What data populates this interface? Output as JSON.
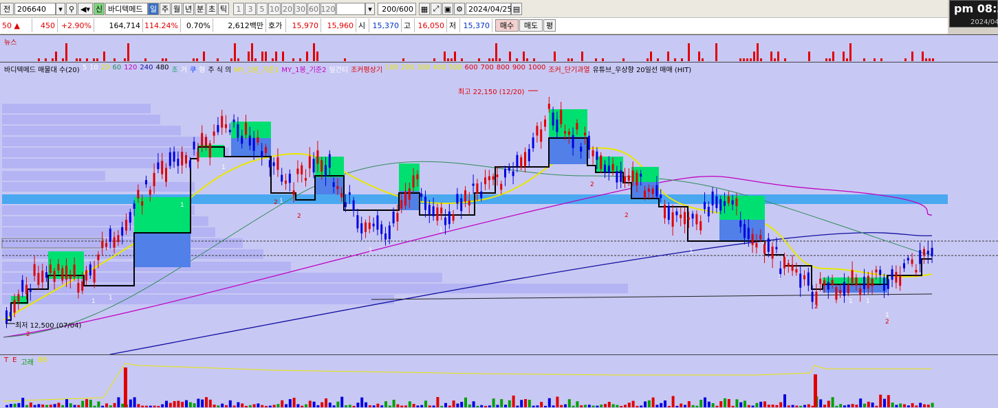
{
  "toolbar": {
    "row1": {
      "prefix": "전",
      "code": "206640",
      "badge": "신",
      "name": "바디텍메드",
      "periods": [
        "일",
        "주",
        "월",
        "년",
        "분",
        "초",
        "틱"
      ],
      "selected_period": "일",
      "numbers": [
        "1",
        "3",
        "5",
        "10",
        "20",
        "30",
        "60",
        "120"
      ],
      "count": "200/600",
      "date": "2024/04/25"
    },
    "row2": {
      "cells": [
        {
          "text": "50 ▲",
          "color": "red"
        },
        {
          "text": "450",
          "color": "red"
        },
        {
          "text": "+2.90%",
          "color": "red"
        },
        {
          "text": "164,714",
          "color": "black"
        },
        {
          "text": "114.24%",
          "color": "red"
        },
        {
          "text": "0.70%",
          "color": "black"
        },
        {
          "text": "2,612백만",
          "color": "black"
        },
        {
          "text": "호가",
          "color": "black"
        },
        {
          "text": "15,970",
          "color": "red"
        },
        {
          "text": "15,960",
          "color": "red"
        },
        {
          "text": "시",
          "color": "black"
        },
        {
          "text": "15,370",
          "color": "blue"
        },
        {
          "text": "고",
          "color": "black"
        },
        {
          "text": "16,050",
          "color": "red"
        },
        {
          "text": "저",
          "color": "black"
        },
        {
          "text": "15,370",
          "color": "blue"
        }
      ],
      "buy_label": "매수",
      "sell_label": "매도",
      "avg_label": "평"
    }
  },
  "clock": {
    "time": "pm 08:3",
    "date": "2024/04"
  },
  "news_panel": {
    "title": "뉴스"
  },
  "price_panel": {
    "legend": [
      {
        "text": "바디텍메드 매물대 수(20)",
        "color": "#000000"
      },
      {
        "text": "5",
        "color": "#ffffff"
      },
      {
        "text": "10",
        "color": "#ffffff"
      },
      {
        "text": "20",
        "color": "#e8e800"
      },
      {
        "text": "60",
        "color": "#2e8b57"
      },
      {
        "text": "120",
        "color": "#c000c0"
      },
      {
        "text": "240",
        "color": "#1010a0"
      },
      {
        "text": "480",
        "color": "#000000"
      },
      {
        "text": "조",
        "color": "#00a060"
      },
      {
        "text": "거",
        "color": "#ffffff"
      },
      {
        "text": "쿠",
        "color": "#0040ff"
      },
      {
        "text": "형",
        "color": "#ffffff"
      },
      {
        "text": "주 식 의",
        "color": "#000000"
      },
      {
        "text": "MY_1봉_기준1",
        "color": "#e8e800"
      },
      {
        "text": "MY_1봉_기준2",
        "color": "#c000c0"
      },
      {
        "text": "일건티",
        "color": "#ffffff"
      },
      {
        "text": "조커평상기",
        "color": "#e00000"
      },
      {
        "text": "100",
        "color": "#e8e800"
      },
      {
        "text": "200",
        "color": "#e8e800"
      },
      {
        "text": "300",
        "color": "#e8e800"
      },
      {
        "text": "400",
        "color": "#e8e800"
      },
      {
        "text": "500",
        "color": "#e8e800"
      },
      {
        "text": "600",
        "color": "#e00000"
      },
      {
        "text": "700",
        "color": "#e00000"
      },
      {
        "text": "800",
        "color": "#e00000"
      },
      {
        "text": "900",
        "color": "#e00000"
      },
      {
        "text": "1000",
        "color": "#e00000"
      },
      {
        "text": "조커_단기과열",
        "color": "#e00000"
      },
      {
        "text": "유튜브_우상향 20일선 매매 (HIT)",
        "color": "#000000"
      }
    ],
    "high_annotation": "최고 22,150 (12/20)",
    "low_annotation": "최저 12,500 (07/04)"
  },
  "volume_panel": {
    "legend": [
      {
        "text": "T",
        "color": "#e00000"
      },
      {
        "text": "E",
        "color": "#e00000"
      },
      {
        "text": "고래",
        "color": "#00a000"
      },
      {
        "text": "BB",
        "color": "#e8e800"
      }
    ]
  },
  "colors": {
    "panel_bg": "#c8c8f4",
    "up": "#e00000",
    "down": "#0000e0",
    "box_green": "#00e070",
    "box_blue": "#5080e8"
  }
}
